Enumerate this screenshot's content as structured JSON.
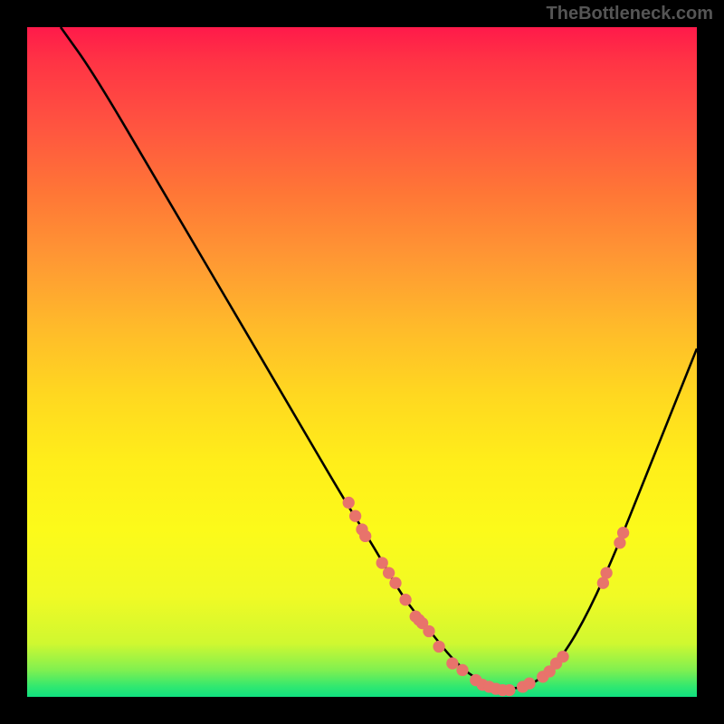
{
  "attribution": "TheBottleneck.com",
  "chart_data": {
    "type": "line",
    "title": "",
    "xlabel": "",
    "ylabel": "",
    "xlim": [
      0,
      100
    ],
    "ylim": [
      0,
      100
    ],
    "curve": [
      {
        "x": 5,
        "y": 100
      },
      {
        "x": 10,
        "y": 93
      },
      {
        "x": 20,
        "y": 76
      },
      {
        "x": 30,
        "y": 59
      },
      {
        "x": 40,
        "y": 42
      },
      {
        "x": 47,
        "y": 30
      },
      {
        "x": 52,
        "y": 22
      },
      {
        "x": 56,
        "y": 15
      },
      {
        "x": 60,
        "y": 10
      },
      {
        "x": 64,
        "y": 5
      },
      {
        "x": 68,
        "y": 2
      },
      {
        "x": 72,
        "y": 1
      },
      {
        "x": 76,
        "y": 2
      },
      {
        "x": 80,
        "y": 6
      },
      {
        "x": 84,
        "y": 13
      },
      {
        "x": 88,
        "y": 22
      },
      {
        "x": 92,
        "y": 32
      },
      {
        "x": 96,
        "y": 42
      },
      {
        "x": 100,
        "y": 52
      }
    ],
    "data_points": [
      {
        "x": 48,
        "y": 29
      },
      {
        "x": 49,
        "y": 27
      },
      {
        "x": 50,
        "y": 25
      },
      {
        "x": 50.5,
        "y": 24
      },
      {
        "x": 53,
        "y": 20
      },
      {
        "x": 54,
        "y": 18.5
      },
      {
        "x": 55,
        "y": 17
      },
      {
        "x": 56.5,
        "y": 14.5
      },
      {
        "x": 58,
        "y": 12
      },
      {
        "x": 58.5,
        "y": 11.5
      },
      {
        "x": 59,
        "y": 11
      },
      {
        "x": 60,
        "y": 9.8
      },
      {
        "x": 61.5,
        "y": 7.5
      },
      {
        "x": 63.5,
        "y": 5
      },
      {
        "x": 65,
        "y": 4
      },
      {
        "x": 67,
        "y": 2.5
      },
      {
        "x": 68,
        "y": 1.8
      },
      {
        "x": 69,
        "y": 1.5
      },
      {
        "x": 70,
        "y": 1.2
      },
      {
        "x": 71,
        "y": 1
      },
      {
        "x": 72,
        "y": 1
      },
      {
        "x": 74,
        "y": 1.5
      },
      {
        "x": 75,
        "y": 2
      },
      {
        "x": 77,
        "y": 3
      },
      {
        "x": 78,
        "y": 3.8
      },
      {
        "x": 79,
        "y": 5
      },
      {
        "x": 80,
        "y": 6
      },
      {
        "x": 86,
        "y": 17
      },
      {
        "x": 86.5,
        "y": 18.5
      },
      {
        "x": 88.5,
        "y": 23
      },
      {
        "x": 89,
        "y": 24.5
      }
    ],
    "colors": {
      "curve": "#000000",
      "points": "#e8736b"
    }
  }
}
